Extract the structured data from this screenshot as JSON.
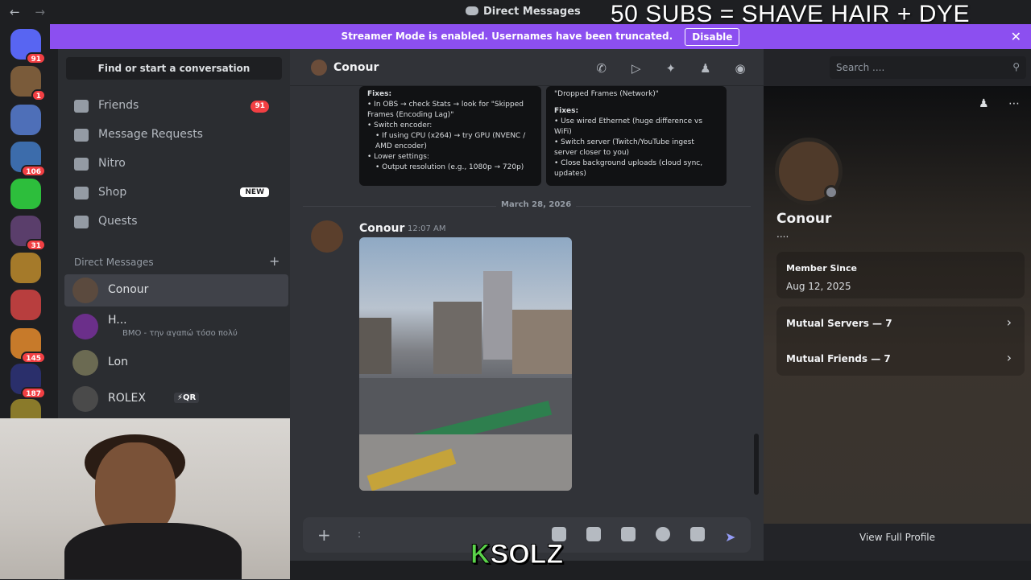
{
  "window": {
    "title": "Direct Messages",
    "back": "←",
    "forward": "→"
  },
  "overlay": {
    "banner_text": "50 SUBS = SHAVE HAIR + DYE HAIR",
    "logo_k": "K",
    "logo_rest": "SOLZ"
  },
  "streamer_mode": {
    "message": "Streamer Mode is enabled. Usernames have been truncated.",
    "disable_label": "Disable",
    "close": "✕"
  },
  "servers": [
    {
      "badge": "91",
      "color": "#5865f2"
    },
    {
      "badge": "1",
      "color": "#7a5b3a"
    },
    {
      "badge": "",
      "color": "#4e6fb8"
    },
    {
      "badge": "106",
      "color": "#3c6cab"
    },
    {
      "badge": "",
      "color": "#2dbe3c"
    },
    {
      "badge": "31",
      "color": "#5a3e6b"
    },
    {
      "badge": "",
      "color": "#a57a2a"
    },
    {
      "badge": "",
      "color": "#b83e3e"
    },
    {
      "badge": "145",
      "color": "#c77a2a"
    },
    {
      "badge": "187",
      "color": "#2a2f6b"
    },
    {
      "badge": "",
      "color": "#8a7a2a"
    }
  ],
  "sidebar": {
    "search_placeholder": "Find or start a conversation",
    "nav": [
      {
        "label": "Friends",
        "badge": "91"
      },
      {
        "label": "Message Requests"
      },
      {
        "label": "Nitro"
      },
      {
        "label": "Shop",
        "tag": "NEW"
      },
      {
        "label": "Quests"
      }
    ],
    "dm_header": "Direct Messages",
    "dm_add": "+",
    "dms": [
      {
        "name": "Conour"
      },
      {
        "name": "H...",
        "sub": "BMO - την αγαπώ τόσο πολύ"
      },
      {
        "name": "Lon"
      },
      {
        "name": "ROLEX",
        "tag": "⚡QR"
      }
    ]
  },
  "chat": {
    "recipient": "Conour",
    "search_placeholder": "Search ....",
    "screenshot_left": {
      "heading": "Fixes:",
      "lines": [
        "• In OBS → check Stats → look for \"Skipped Frames (Encoding Lag)\"",
        "• Switch encoder:",
        "• If using CPU (x264) → try GPU (NVENC / AMD encoder)",
        "• Lower settings:",
        "• Output resolution (e.g., 1080p → 720p)"
      ]
    },
    "screenshot_right": {
      "top_line": "\"Dropped Frames (Network)\"",
      "heading": "Fixes:",
      "lines": [
        "• Use wired Ethernet (huge difference vs WiFi)",
        "• Switch server (Twitch/YouTube ingest server closer to you)",
        "• Close background uploads (cloud sync, updates)"
      ]
    },
    "date_divider": "March 28, 2026",
    "message": {
      "author": "Conour",
      "time": "12:07 AM"
    },
    "composer_placeholder": ":",
    "send": "➤"
  },
  "profile": {
    "name": "Conour",
    "dots": "....",
    "member_since_label": "Member Since",
    "member_since": "Aug 12, 2025",
    "mutual_servers": "Mutual Servers — 7",
    "mutual_friends": "Mutual Friends — 7",
    "view_full": "View Full Profile"
  }
}
